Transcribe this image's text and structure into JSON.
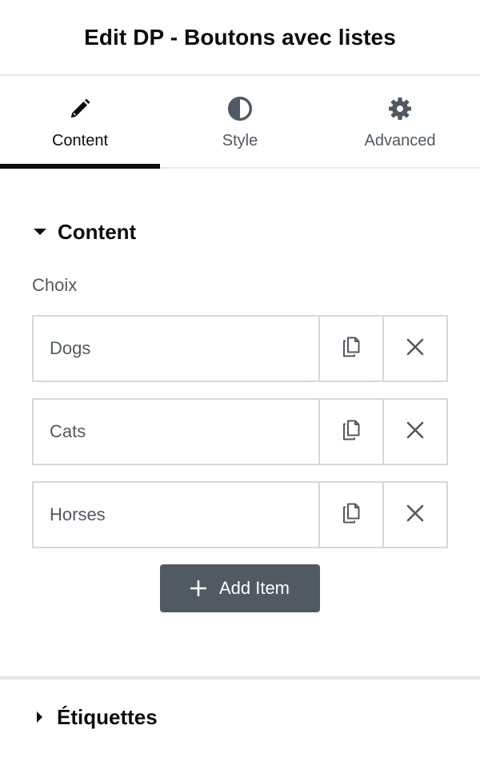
{
  "header": {
    "title": "Edit DP - Boutons avec listes"
  },
  "tabs": [
    {
      "label": "Content",
      "icon": "pencil-icon",
      "active": true
    },
    {
      "label": "Style",
      "icon": "half-circle-icon",
      "active": false
    },
    {
      "label": "Advanced",
      "icon": "gear-icon",
      "active": false
    }
  ],
  "content_section": {
    "title": "Content",
    "field_label": "Choix",
    "items": [
      {
        "title": "Dogs"
      },
      {
        "title": "Cats"
      },
      {
        "title": "Horses"
      }
    ],
    "add_label": "Add Item"
  },
  "labels_section": {
    "title": "Étiquettes"
  },
  "colors": {
    "text": "#0c0d0e",
    "muted": "#515962",
    "border": "#d5d8dc",
    "button_bg": "#515962"
  }
}
